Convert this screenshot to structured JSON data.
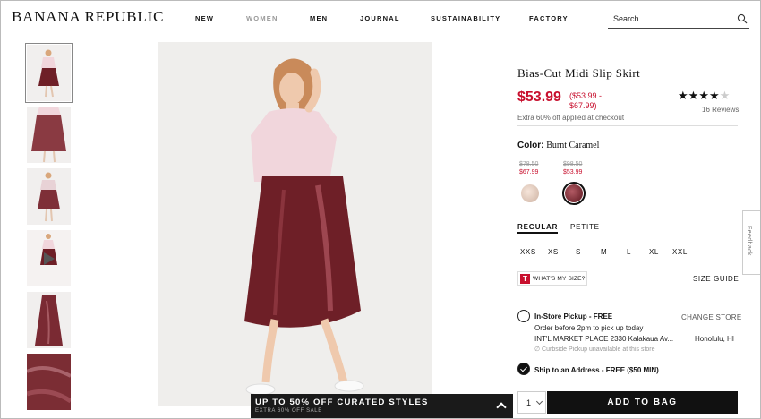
{
  "brand": {
    "logo": "BANANA REPUBLIC"
  },
  "nav": {
    "items": [
      "NEW",
      "WOMEN",
      "MEN",
      "JOURNAL",
      "SUSTAINABILITY",
      "FACTORY"
    ]
  },
  "search": {
    "placeholder": "Search"
  },
  "product": {
    "title": "Bias-Cut Midi Slip Skirt",
    "price": "$53.99",
    "price_range": "($53.99 - $67.99)",
    "promo_note": "Extra 60% off applied at checkout",
    "rating": 4,
    "rating_max": 5,
    "reviews": "16 Reviews",
    "color_label": "Color:",
    "color_value": "Burnt Caramel",
    "swatches": [
      {
        "old_price": "$78.50",
        "new_price": "$67.99",
        "color": "#e6cfc2",
        "selected": false
      },
      {
        "old_price": "$98.50",
        "new_price": "$53.99",
        "color": "#6e1f27",
        "selected": true
      }
    ],
    "fits": [
      "REGULAR",
      "PETITE"
    ],
    "selected_fit": "REGULAR",
    "sizes": [
      "XXS",
      "XS",
      "S",
      "M",
      "L",
      "XL",
      "XXL"
    ],
    "whats_my_size": "WHAT'S MY SIZE?",
    "whats_my_size_badge": "T",
    "size_guide": "SIZE GUIDE"
  },
  "shipping": {
    "pickup_title": "In-Store Pickup - FREE",
    "pickup_note": "Order before 2pm to pick up today",
    "store_name": "INT'L MARKET PLACE 2330 Kalakaua Av...",
    "store_city": "Honolulu, HI",
    "curbside": "∅ Curbside Pickup unavailable at this store",
    "change_store": "CHANGE STORE",
    "ship_title": "Ship to an Address - FREE ($50 MIN)",
    "selected_option": "ship"
  },
  "cart": {
    "quantity": "1",
    "add_to_bag": "ADD TO BAG"
  },
  "banner": {
    "headline": "UP TO 50% OFF CURATED STYLES",
    "sub": "EXTRA 60% OFF SALE"
  },
  "feedback": {
    "label": "Feedback"
  },
  "colors": {
    "sale_red": "#c8102e",
    "skirt": "#6e1f27",
    "top": "#f1d6dc"
  }
}
